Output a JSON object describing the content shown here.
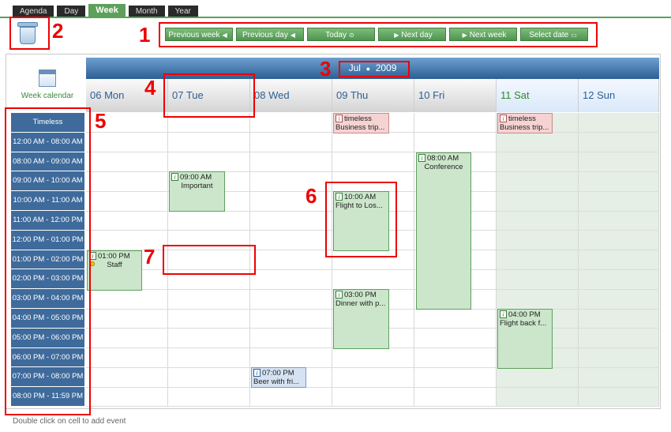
{
  "tabs": [
    "Agenda",
    "Day",
    "Week",
    "Month",
    "Year"
  ],
  "active_tab": "Week",
  "nav": {
    "previous_week": "Previous week",
    "previous_day": "Previous day",
    "today": "Today",
    "next_day": "Next day",
    "next_week": "Next week",
    "select_date": "Select date"
  },
  "sidebar": {
    "week_calendar": "Week calendar"
  },
  "header": {
    "month": "Jul",
    "year": "2009",
    "separator": "●"
  },
  "days": [
    "06 Mon",
    "07 Tue",
    "08 Wed",
    "09 Thu",
    "10 Fri",
    "11 Sat",
    "12 Sun"
  ],
  "time_slots": [
    "Timeless",
    "12:00 AM - 08:00 AM",
    "08:00 AM - 09:00 AM",
    "09:00 AM - 10:00 AM",
    "10:00 AM - 11:00 AM",
    "11:00 AM - 12:00 PM",
    "12:00 PM - 01:00 PM",
    "01:00 PM - 02:00 PM",
    "02:00 PM - 03:00 PM",
    "03:00 PM - 04:00 PM",
    "04:00 PM - 05:00 PM",
    "05:00 PM - 06:00 PM",
    "06:00 PM - 07:00 PM",
    "07:00 PM - 08:00 PM",
    "08:00 PM - 11:59 PM"
  ],
  "events": [
    {
      "time": "timeless",
      "title": "Business trip...",
      "color": "pink"
    },
    {
      "time": "timeless",
      "title": "Business trip...",
      "color": "pink"
    },
    {
      "time": "08:00 AM",
      "title": "Conference",
      "color": "green"
    },
    {
      "time": "09:00 AM",
      "title": "Important",
      "color": "green"
    },
    {
      "time": "10:00 AM",
      "title": "Flight to Los...",
      "color": "green"
    },
    {
      "time": "01:00 PM",
      "title": "Staff",
      "color": "green"
    },
    {
      "time": "03:00 PM",
      "title": "Dinner with p...",
      "color": "green"
    },
    {
      "time": "04:00 PM",
      "title": "Flight back f...",
      "color": "green"
    },
    {
      "time": "07:00 PM",
      "title": "Beer with fri...",
      "color": "blue"
    }
  ],
  "annotations": [
    "1",
    "2",
    "3",
    "4",
    "5",
    "6",
    "7"
  ],
  "footer": "Double click on cell to add event",
  "colors": {
    "accent_green": "#5ca05c",
    "header_blue": "#2d5f94",
    "time_blue": "#3f6b9c"
  }
}
